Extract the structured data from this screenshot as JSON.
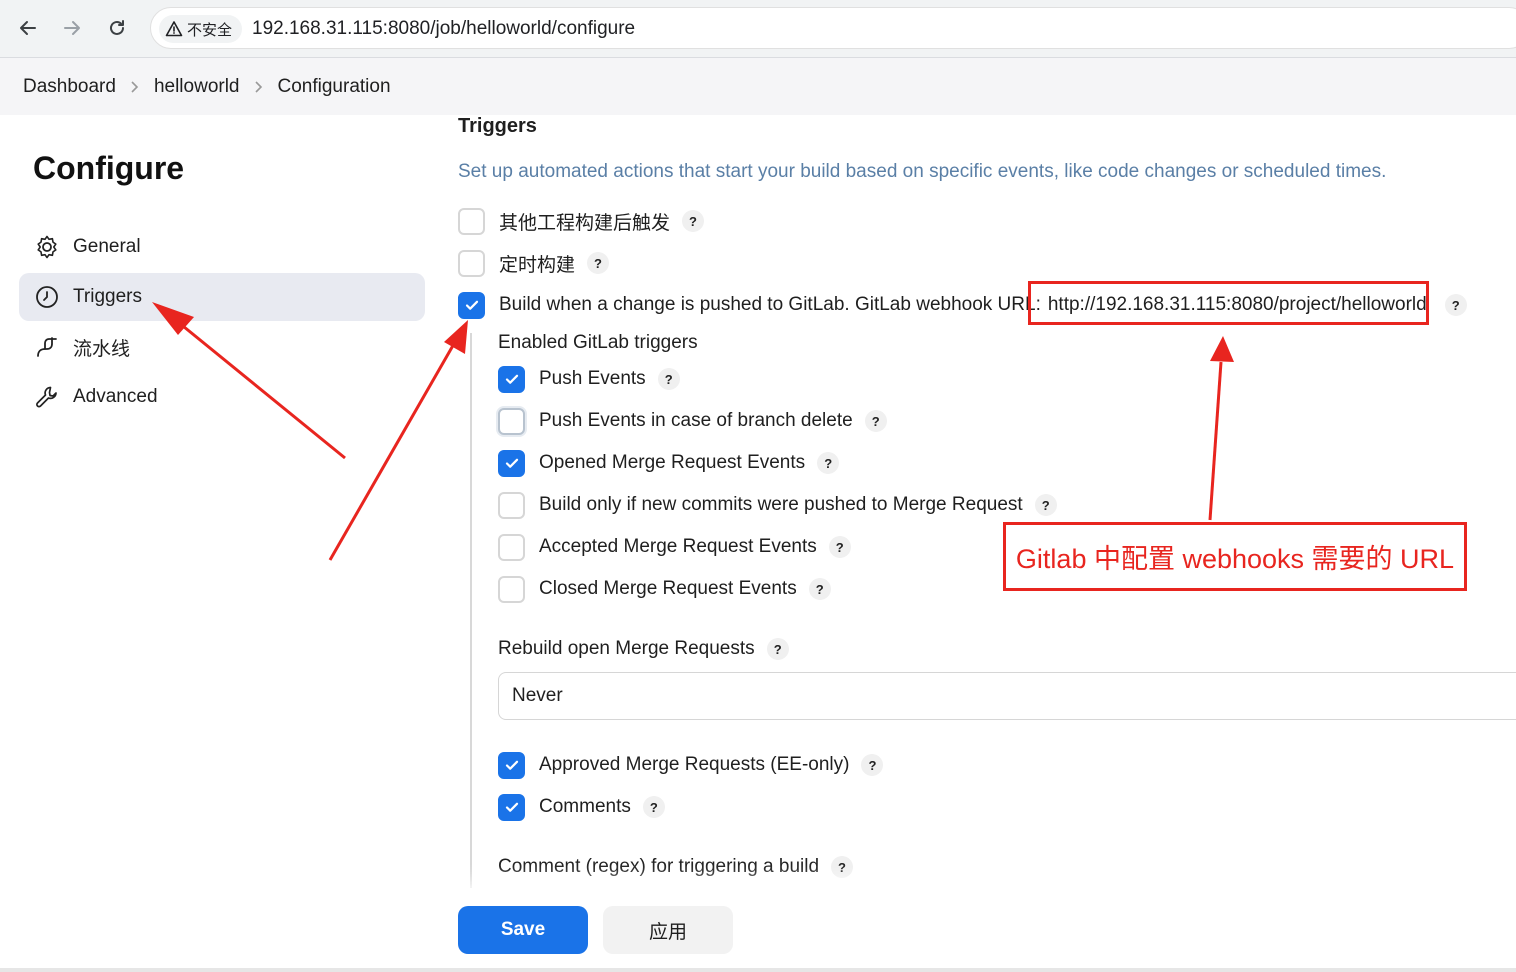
{
  "browser": {
    "security_label": "不安全",
    "url": "192.168.31.115:8080/job/helloworld/configure"
  },
  "breadcrumb": {
    "items": [
      "Dashboard",
      "helloworld",
      "Configuration"
    ]
  },
  "sidebar": {
    "title": "Configure",
    "items": [
      {
        "label": "General",
        "icon": "gear-icon"
      },
      {
        "label": "Triggers",
        "icon": "clock-icon",
        "active": true
      },
      {
        "label": "流水线",
        "icon": "pipeline-icon"
      },
      {
        "label": "Advanced",
        "icon": "wrench-icon"
      }
    ]
  },
  "triggers": {
    "title": "Triggers",
    "description": "Set up automated actions that start your build based on specific events, like code changes or scheduled times.",
    "options": [
      {
        "label": "其他工程构建后触发",
        "checked": false
      },
      {
        "label": "定时构建",
        "checked": false
      },
      {
        "label": "Build when a change is pushed to GitLab. GitLab webhook URL:",
        "checked": true
      }
    ],
    "webhook_url": "http://192.168.31.115:8080/project/helloworld",
    "gitlab": {
      "heading": "Enabled GitLab triggers",
      "events": [
        {
          "label": "Push Events",
          "checked": true
        },
        {
          "label": "Push Events in case of branch delete",
          "checked": false
        },
        {
          "label": "Opened Merge Request Events",
          "checked": true
        },
        {
          "label": "Build only if new commits were pushed to Merge Request",
          "checked": false
        },
        {
          "label": "Accepted Merge Request Events",
          "checked": false
        },
        {
          "label": "Closed Merge Request Events",
          "checked": false
        }
      ],
      "rebuild_label": "Rebuild open Merge Requests",
      "rebuild_value": "Never",
      "extra": [
        {
          "label": "Approved Merge Requests (EE-only)",
          "checked": true
        },
        {
          "label": "Comments",
          "checked": true
        }
      ],
      "comment_regex_label": "Comment (regex) for triggering a build"
    }
  },
  "footer": {
    "save_label": "Save",
    "apply_label": "应用"
  },
  "annotation": {
    "text": "Gitlab 中配置 webhooks 需要的 URL",
    "color": "#e8251f"
  },
  "colors": {
    "primary": "#1a73e8",
    "description_text": "#5a7fa6",
    "active_nav_bg": "#e8eaf1"
  }
}
